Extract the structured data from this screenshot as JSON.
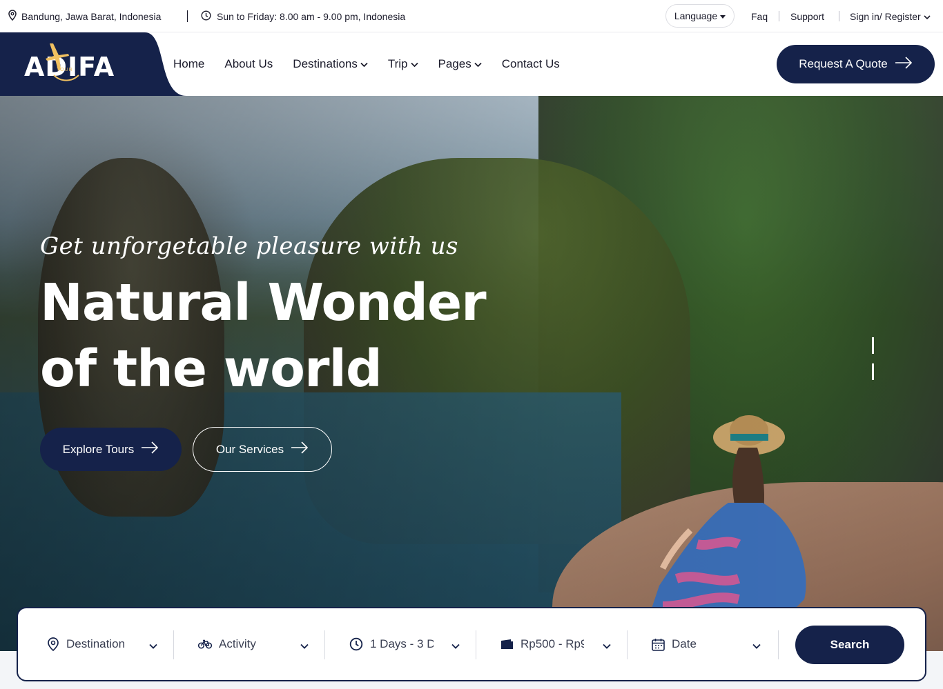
{
  "topbar": {
    "location": "Bandung, Jawa Barat, Indonesia",
    "hours": "Sun to Friday: 8.00 am - 9.00 pm, Indonesia",
    "language": "Language",
    "faq": "Faq",
    "support": "Support",
    "signin": "Sign in/ Register"
  },
  "header": {
    "logo_text": "ADIFA",
    "logo_sub": "TOUR",
    "nav": {
      "home": "Home",
      "about": "About Us",
      "destinations": "Destinations",
      "trip": "Trip",
      "pages": "Pages",
      "contact": "Contact Us"
    },
    "quote_button": "Request A Quote"
  },
  "hero": {
    "subtitle": "Get unforgetable pleasure with us",
    "headline_line1": "Natural Wonder",
    "headline_line2": "of the world",
    "explore_button": "Explore Tours",
    "services_button": "Our Services"
  },
  "search": {
    "destination": "Destination",
    "activity": "Activity",
    "duration": "1 Days - 3 D",
    "price": "Rp500 - Rp9",
    "date": "Date",
    "search_button": "Search"
  },
  "colors": {
    "primary": "#15224a",
    "white": "#ffffff"
  }
}
